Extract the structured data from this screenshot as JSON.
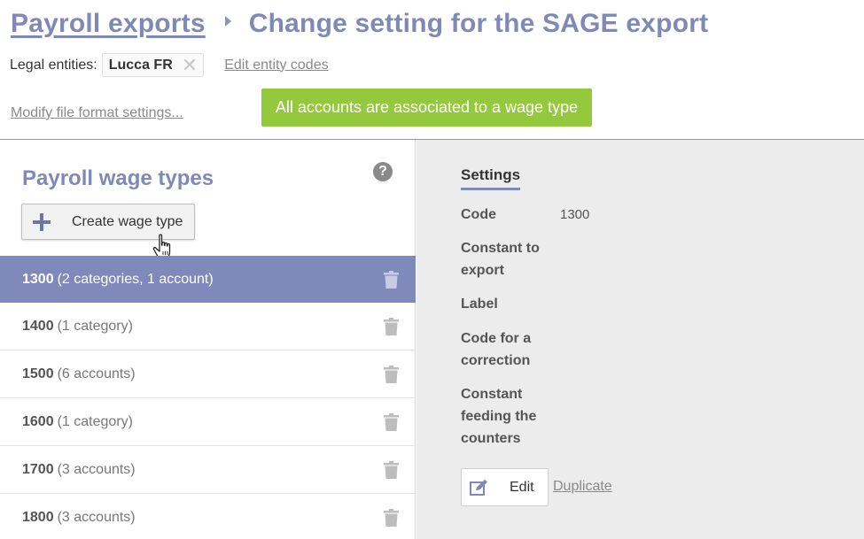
{
  "breadcrumb": {
    "parent_label": "Payroll exports",
    "current_title": "Change setting for the SAGE export"
  },
  "entities": {
    "label": "Legal entities:",
    "selected": "Lucca FR",
    "edit_codes_label": "Edit entity codes"
  },
  "links": {
    "modify_format": "Modify file format settings..."
  },
  "status": {
    "message": "All accounts are associated to a wage type",
    "color": "#95c93d"
  },
  "left_panel": {
    "title": "Payroll wage types",
    "help_icon": "question-circle-icon",
    "create_button_label": "Create wage type",
    "wage_types": [
      {
        "code": "1300",
        "detail": "(2 categories, 1 account)",
        "selected": true
      },
      {
        "code": "1400",
        "detail": "(1 category)",
        "selected": false
      },
      {
        "code": "1500",
        "detail": "(6 accounts)",
        "selected": false
      },
      {
        "code": "1600",
        "detail": "(1 category)",
        "selected": false
      },
      {
        "code": "1700",
        "detail": "(3 accounts)",
        "selected": false
      },
      {
        "code": "1800",
        "detail": "(3 accounts)",
        "selected": false
      }
    ]
  },
  "settings": {
    "tab_label": "Settings",
    "fields": [
      {
        "label": "Code",
        "value": "1300"
      },
      {
        "label": "Constant to export",
        "value": ""
      },
      {
        "label": "Label",
        "value": ""
      },
      {
        "label": "Code for a correction",
        "value": ""
      },
      {
        "label": "Constant feeding the counters",
        "value": ""
      }
    ],
    "edit_label": "Edit",
    "duplicate_label": "Duplicate"
  },
  "colors": {
    "accent": "#8089b5",
    "selected_row": "#7f89ba",
    "right_panel_bg": "#ececec"
  }
}
